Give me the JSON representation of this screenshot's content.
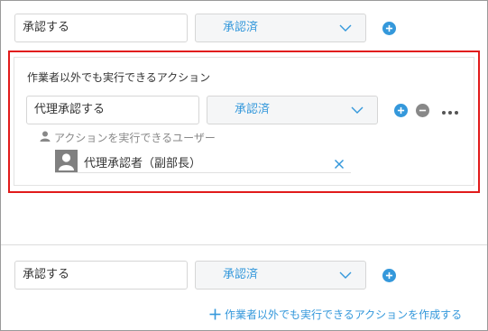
{
  "row1": {
    "action_value": "承認する",
    "status_value": "承認済"
  },
  "panel": {
    "title": "作業者以外でも実行できるアクション",
    "action_value": "代理承認する",
    "status_value": "承認済",
    "executors_label": "アクションを実行できるユーザー",
    "user_name": "代理承認者（副部長）"
  },
  "row2": {
    "action_value": "承認する",
    "status_value": "承認済"
  },
  "create_link_label": "作業者以外でも実行できるアクションを作成する",
  "colors": {
    "accent": "#3498db",
    "highlight": "#e11b1b",
    "neutral": "#888888"
  },
  "icons": [
    "plus-circle-icon",
    "minus-circle-icon",
    "more-icon",
    "user-icon",
    "close-icon",
    "chevron-down-icon",
    "plus-icon"
  ]
}
